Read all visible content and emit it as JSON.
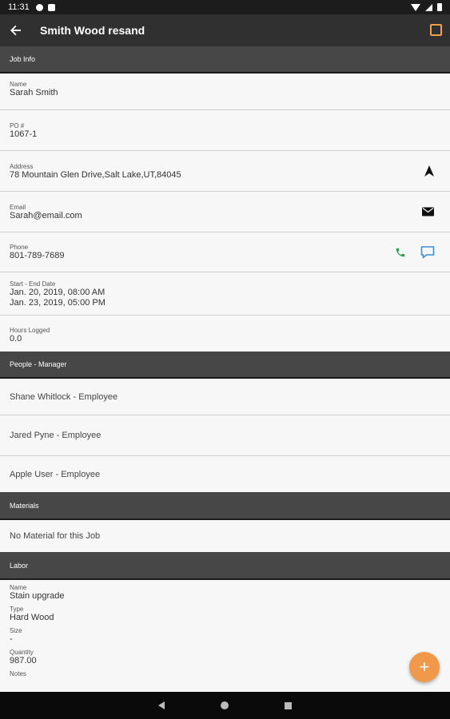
{
  "status_bar": {
    "time": "11:31"
  },
  "app_bar": {
    "title": "Smith Wood resand"
  },
  "sections": {
    "job_info": "Job Info",
    "people": "People - Manager",
    "materials": "Materials",
    "labor": "Labor"
  },
  "job": {
    "name_label": "Name",
    "name": "Sarah Smith",
    "po_label": "PO #",
    "po": "1067-1",
    "address_label": "Address",
    "address": "78 Mountain Glen Drive,Salt Lake,UT,84045",
    "email_label": "Email",
    "email": "Sarah@email.com",
    "phone_label": "Phone",
    "phone": "801-789-7689",
    "dates_label": "Start - End Date",
    "start": "Jan. 20, 2019, 08:00 AM",
    "end": "Jan. 23, 2019, 05:00 PM",
    "hours_label": "Hours Logged",
    "hours": "0.0"
  },
  "people": [
    "Shane Whitlock - Employee",
    "Jared Pyne - Employee",
    "Apple User - Employee"
  ],
  "materials": {
    "empty": "No Material for this Job"
  },
  "labor": {
    "name_label": "Name",
    "name": "Stain upgrade",
    "type_label": "Type",
    "type": "Hard Wood",
    "size_label": "Size",
    "size": "-",
    "quantity_label": "Quantity",
    "quantity": "987.00",
    "notes_label": "Notes"
  },
  "fab": {
    "label": "+"
  },
  "colors": {
    "accent": "#f0994b",
    "phone_green": "#2e9e4f",
    "message_blue": "#3a8fd8",
    "header": "#474747"
  },
  "icons": [
    "back-arrow-icon",
    "edit-square-icon",
    "navigation-icon",
    "mail-icon",
    "phone-icon",
    "message-icon",
    "add-icon"
  ]
}
